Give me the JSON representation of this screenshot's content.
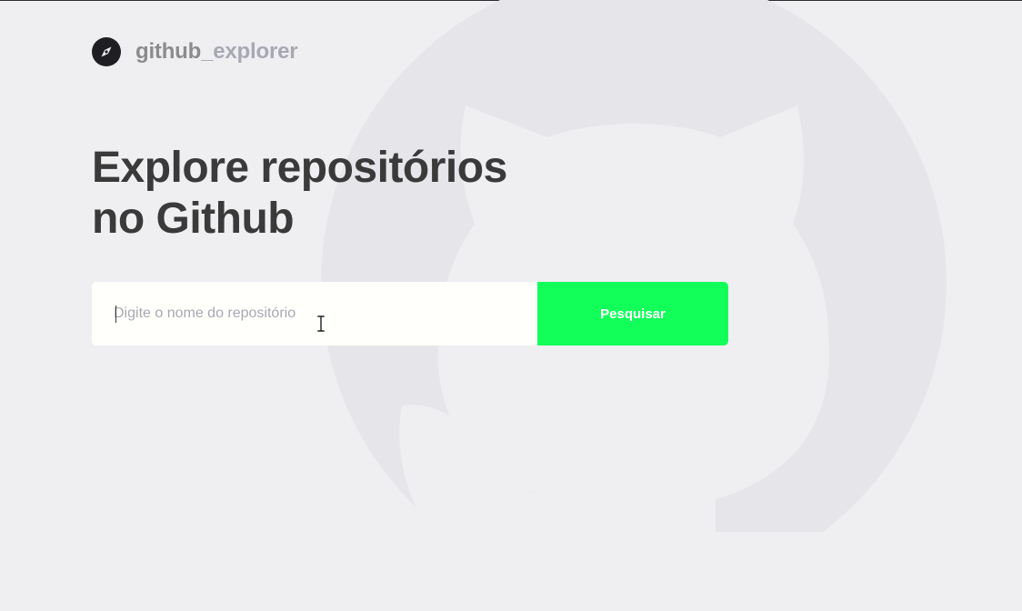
{
  "brand": {
    "name_primary": "github",
    "name_secondary": "_explorer",
    "logo_icon": "compass-icon"
  },
  "hero": {
    "title_line_1": "Explore repositórios",
    "title_line_2": "no Github"
  },
  "search": {
    "placeholder": "Digite o nome do repositório",
    "value": "",
    "button_label": "Pesquisar"
  },
  "colors": {
    "background": "#efeff2",
    "title_text": "#3a3a3a",
    "muted_text": "#a8a8b3",
    "button": "#12ff5a",
    "input_background": "#fffffb"
  },
  "background_icon": "github-octocat-icon"
}
